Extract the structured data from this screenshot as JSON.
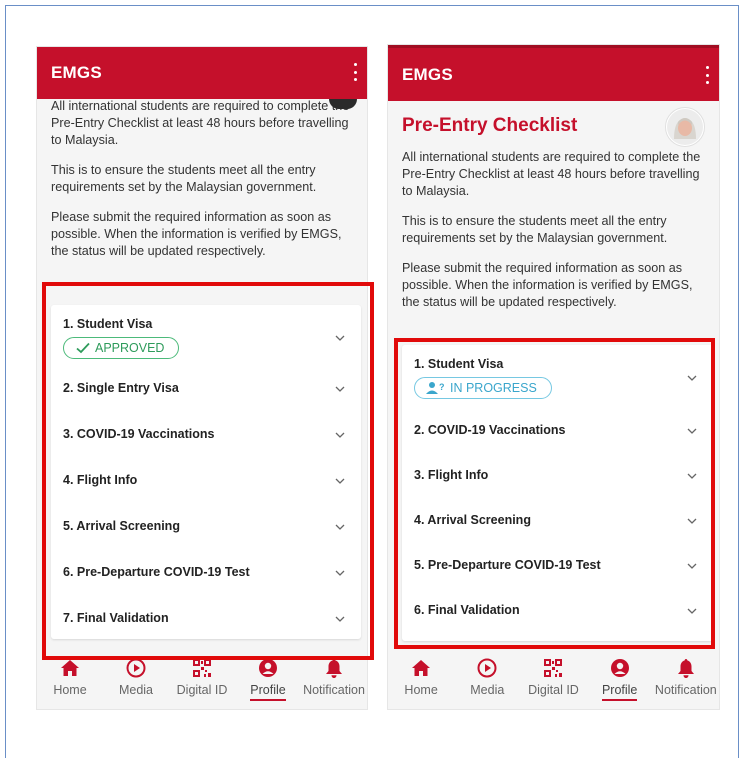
{
  "left_screen": {
    "app_title": "EMGS",
    "intro": [
      "All international students are required to complete the Pre-Entry Checklist at least 48 hours before travelling to Malaysia.",
      "This is to ensure the students meet all the entry requirements set by the Malaysian government.",
      "Please submit the required information as soon as possible. When the information is verified by EMGS, the status will be updated respectively."
    ],
    "items": [
      {
        "label": "1. Student Visa",
        "badge": "APPROVED"
      },
      {
        "label": "2. Single Entry Visa"
      },
      {
        "label": "3. COVID-19 Vaccinations"
      },
      {
        "label": "4. Flight Info"
      },
      {
        "label": "5. Arrival Screening"
      },
      {
        "label": "6. Pre-Departure COVID-19 Test"
      },
      {
        "label": "7. Final Validation"
      }
    ]
  },
  "right_screen": {
    "app_title": "EMGS",
    "page_title": "Pre-Entry Checklist",
    "intro": [
      "All international students are required to complete the Pre-Entry Checklist at least 48 hours before travelling to Malaysia.",
      "This is to ensure the students meet all the entry requirements set by the Malaysian government.",
      "Please submit the required information as soon as possible. When the information is verified by EMGS, the status will be updated respectively."
    ],
    "items": [
      {
        "label": "1. Student Visa",
        "badge": "IN PROGRESS"
      },
      {
        "label": "2. COVID-19 Vaccinations"
      },
      {
        "label": "3. Flight Info"
      },
      {
        "label": "4. Arrival Screening"
      },
      {
        "label": "5. Pre-Departure COVID-19 Test"
      },
      {
        "label": "6. Final Validation"
      }
    ]
  },
  "bottom_nav": [
    "Home",
    "Media",
    "Digital ID",
    "Profile",
    "Notification"
  ],
  "active_tab": "Profile",
  "colors": {
    "brand_red": "#c5102b",
    "highlight_red": "#e10a0a",
    "approved_green": "#2e9b5b",
    "in_progress_blue": "#3aa6cc"
  },
  "icons": [
    "home-icon",
    "play-circle-icon",
    "qr-code-icon",
    "person-circle-icon",
    "bell-icon",
    "chevron-down-icon",
    "check-icon",
    "user-question-icon",
    "kebab-menu-icon"
  ]
}
